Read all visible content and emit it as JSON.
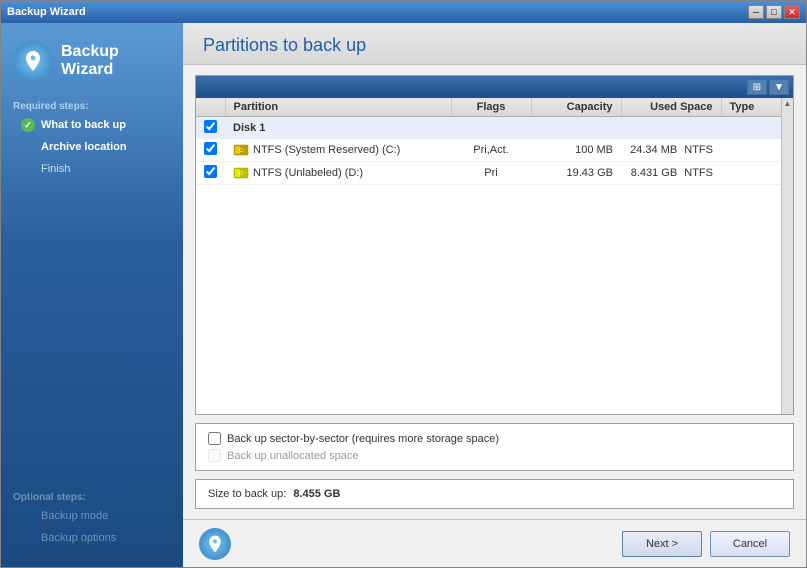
{
  "window": {
    "title": "Backup Wizard",
    "title_bar_title": "Backup Wizard"
  },
  "wizard": {
    "title": "Backup Wizard",
    "icon_label": "backup-wizard-icon"
  },
  "sidebar": {
    "required_section_title": "Required steps:",
    "items": [
      {
        "id": "what-to-backup",
        "label": "What to back up",
        "state": "completed"
      },
      {
        "id": "archive-location",
        "label": "Archive location",
        "state": "active"
      },
      {
        "id": "finish",
        "label": "Finish",
        "state": "inactive"
      }
    ],
    "optional_section_title": "Optional steps:",
    "optional_items": [
      {
        "id": "backup-mode",
        "label": "Backup mode",
        "state": "disabled"
      },
      {
        "id": "backup-options",
        "label": "Backup options",
        "state": "disabled"
      }
    ]
  },
  "main": {
    "title": "Partitions to back up",
    "table": {
      "columns": [
        {
          "id": "check",
          "label": ""
        },
        {
          "id": "partition",
          "label": "Partition"
        },
        {
          "id": "flags",
          "label": "Flags"
        },
        {
          "id": "capacity",
          "label": "Capacity"
        },
        {
          "id": "usedspace",
          "label": "Used Space"
        },
        {
          "id": "type",
          "label": "Type"
        }
      ],
      "disk_groups": [
        {
          "id": "disk1",
          "label": "Disk 1",
          "checked": true,
          "partitions": [
            {
              "id": "p1",
              "name": "NTFS (System Reserved) (C:)",
              "icon_type": "system",
              "flags": "Pri,Act.",
              "capacity": "100 MB",
              "used_space": "24.34 MB",
              "type": "NTFS",
              "checked": true
            },
            {
              "id": "p2",
              "name": "NTFS (Unlabeled) (D:)",
              "icon_type": "normal",
              "flags": "Pri",
              "capacity": "19.43 GB",
              "used_space": "8.431 GB",
              "type": "NTFS",
              "checked": true
            }
          ]
        }
      ]
    },
    "options": [
      {
        "id": "sector-by-sector",
        "label": "Back up sector-by-sector (requires more storage space)",
        "checked": false,
        "disabled": false
      },
      {
        "id": "unallocated",
        "label": "Back up unallocated space",
        "checked": false,
        "disabled": true
      }
    ],
    "size_label": "Size to back up:",
    "size_value": "8.455 GB"
  },
  "footer": {
    "next_label": "Next >",
    "cancel_label": "Cancel"
  }
}
